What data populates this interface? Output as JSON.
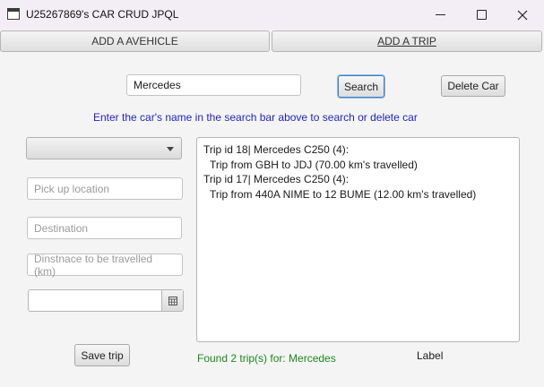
{
  "window": {
    "title": "U25267869's CAR CRUD JPQL",
    "icons": {
      "app": "app-window-icon",
      "minimize": "minimize-icon",
      "maximize": "maximize-icon",
      "close": "close-icon"
    }
  },
  "tabs": {
    "vehicle_label": "ADD A AVEHICLE",
    "trip_label": "ADD A TRIP"
  },
  "search": {
    "value": "Mercedes",
    "button_label": "Search",
    "delete_label": "Delete Car",
    "hint": "Enter the car's name in the search bar above to search or delete car"
  },
  "form": {
    "car_select_value": "",
    "pickup_placeholder": "Pick up location",
    "destination_placeholder": "Destination",
    "distance_placeholder": "Dinstnace to be travelled (km)",
    "date_value": "",
    "calendar_icon": "calendar-icon",
    "save_label": "Save trip"
  },
  "results": {
    "lines": [
      "Trip id 18| Mercedes C250 (4):",
      "Trip from GBH to JDJ (70.00 km's travelled)",
      "Trip id 17| Mercedes C250 (4):",
      "Trip from 440A NIME to 12 BUME (12.00 km's travelled)"
    ],
    "status": "Found 2 trip(s) for: Mercedes",
    "label": "Label"
  },
  "colors": {
    "hint_text": "#2323c8",
    "status_text": "#1a8a1a",
    "focus_border": "#3a7fc1"
  }
}
